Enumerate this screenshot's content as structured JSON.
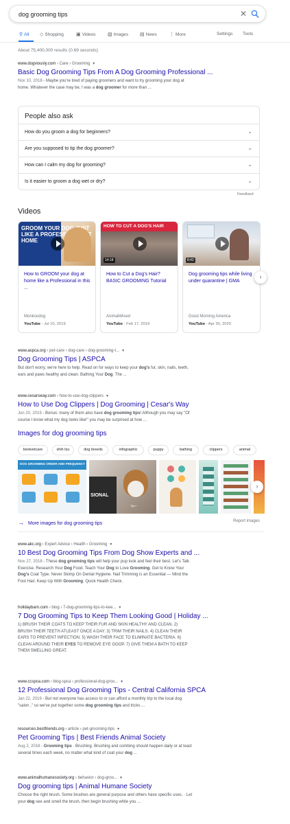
{
  "search": {
    "query": "dog grooming tips",
    "clear_icon": "close-icon",
    "search_icon": "search-icon"
  },
  "tabs": [
    {
      "label": "All",
      "icon": "search-icon",
      "active": true
    },
    {
      "label": "Shopping",
      "icon": "tag-icon"
    },
    {
      "label": "Videos",
      "icon": "video-icon"
    },
    {
      "label": "Images",
      "icon": "image-icon"
    },
    {
      "label": "News",
      "icon": "news-icon"
    },
    {
      "label": "More",
      "icon": "more-vertical-icon"
    }
  ],
  "tools": {
    "settings": "Settings",
    "tools": "Tools"
  },
  "stats": "About 75,400,000 results (0.69 seconds)",
  "colors": {
    "link": "#1a0dab",
    "accent": "#1a73e8",
    "text": "#202124",
    "muted": "#70757a"
  },
  "result1": {
    "domain": "www.dogviously.com",
    "path": " › Care › Grooming",
    "title": "Basic Dog Grooming Tips From A Dog Grooming Professional ...",
    "date": "Nov 10, 2018",
    "snippet_line1": " - Maybe you're tired of paying groomers and want to try grooming your dog at",
    "snippet_line2_a": "home. Whatever the case may be, I was a ",
    "snippet_line2_b": "dog groomer",
    "snippet_line2_c": " for more than ..."
  },
  "paa": {
    "title": "People also ask",
    "questions": [
      "How do you groom a dog for beginners?",
      "Are you supposed to tip the dog groomer?",
      "How can I calm my dog for grooming?",
      "Is it easier to groom a dog wet or dry?"
    ],
    "feedback": "Feedback"
  },
  "videos": {
    "heading": "Videos",
    "items": [
      {
        "title": "How to GROOM your dog at home like a Professional in this ...",
        "source": "Monkoodog",
        "platform": "YouTube",
        "date": " - Jul 10, 2019",
        "duration": "",
        "thumb_text": "GROOM YOUR DOG JUST LIKE A PROFESSIONAL AT HOME"
      },
      {
        "title": "How to Cut a Dog's Hair? BASIC GROOMING Tutorial",
        "source": "AnimalWised",
        "platform": "YouTube",
        "date": " - Feb 17, 2019",
        "duration": "14:18",
        "thumb_text": "HOW TO CUT A DOG'S HAIR"
      },
      {
        "title": "Dog grooming tips while living under quarantine | GMA",
        "source": "Good Morning America",
        "platform": "YouTube",
        "date": " - Apr 30, 2020",
        "duration": "8:42"
      }
    ]
  },
  "result2": {
    "domain": "www.aspca.org",
    "path": " › pet-care › dog-care › dog-grooming-t...",
    "title": "Dog Grooming Tips | ASPCA",
    "line1_a": "But don't worry, we're here to help. Read on for ways to keep your ",
    "line1_b": "dog's",
    "line1_c": " fur, skin, nails, teeth,",
    "line2_a": "ears and paws healthy and clean. Bathing Your ",
    "line2_b": "Dog",
    "line2_c": ". The ..."
  },
  "result3": {
    "domain": "www.cesarsway.com",
    "path": " › how-to-use-dog-clippers",
    "title": "How to Use Dog Clippers | Dog Grooming | Cesar's Way",
    "date": "Jun 20, 2019",
    "line1_a": " - Bonus: many of them also have ",
    "line1_b": "dog grooming tips",
    "line1_c": "! Although you may say \"Of",
    "line2": "course I know what my dog looks like!\" you may be surprised at how ..."
  },
  "images": {
    "heading": "Images for dog grooming tips",
    "chips": [
      "bestvetcare",
      "shih tzu",
      "dog breeds",
      "infographic",
      "puppy",
      "bathing",
      "clippers",
      "animal"
    ],
    "tile1_title": "DOG GROOMING ORDER AND FREQUENCY",
    "tile2_text": "SIONAL",
    "tile2_sub": "Tips ~",
    "more": "More images for dog grooming tips",
    "report": "Report images"
  },
  "result4": {
    "domain": "www.akc.org",
    "path": " › Expert Advice › Health › Grooming",
    "title": "10 Best Dog Grooming Tips From Dog Show Experts and ...",
    "date": "Nov 27, 2018",
    "l1a": " - These ",
    "l1b": "dog grooming tips",
    "l1c": " will help your pup look and feel their best. Let's Talk",
    "l2a": "Exercise. Research Your ",
    "l2b": "Dog",
    "l2c": " Food. Teach Your ",
    "l2d": "Dog",
    "l2e": " to Love ",
    "l2f": "Grooming",
    "l2g": ". Get to Know Your",
    "l3a": "Dog's",
    "l3b": " Coat Type. Never Skimp On Dental Hygiene. Nail Trimming is an Essential — Mind the",
    "l4a": "Foot Hair. Keep Up With ",
    "l4b": "Grooming",
    "l4c": ". Quick Health Check."
  },
  "result5": {
    "domain": "holidaybarn.com",
    "path": " › blog › 7-dog-grooming-tips-to-kee...",
    "title": "7 Dog Grooming Tips to Keep Them Looking Good | Holiday ...",
    "l1": "1) BRUSH THEIR COATS TO KEEP THEIR FUR AND SKIN HEALTHY AND CLEAN. 2)",
    "l2": "BRUSH THEIR TEETH ATLEAST ONCE A DAY. 3) TRIM THEIR NAILS. 4) CLEAN THEIR",
    "l3": "EARS TO PREVENT INFECTION. 5) WASH THEIR FACE TO ELIMINATE BACTERIA. 6)",
    "l4a": "CLEAN AROUND THEIR ",
    "l4b": "EYES",
    "l4c": " TO REMOVE EYE GOOP. 7) GIVE THEM A BATH TO KEEP",
    "l5": "THEM SMELLING GREAT."
  },
  "result6": {
    "domain": "www.ccspca.com",
    "path": " › blog-spca › professional-dog-groo...",
    "title": "12 Professional Dog Grooming Tips - Central California SPCA",
    "date": "Jan 22, 2019",
    "l1": " - But not everyone has access to or can afford a monthly trip to the local dog",
    "l2a": "\"salon ,\" so we've put together some ",
    "l2b": "dog grooming tips",
    "l2c": " and tricks ..."
  },
  "result7": {
    "domain": "resources.bestfriends.org",
    "path": " › article › pet-grooming-tips",
    "title": "Pet Grooming Tips | Best Friends Animal Society",
    "date": "Aug 2, 2018",
    "l1a": " - ",
    "l1b": "Grooming tips",
    "l1c": " · Brushing. Brushing and combing should happen daily or at least",
    "l2a": "several times each week, no matter what kind of coat your ",
    "l2b": "dog",
    "l2c": " ..."
  },
  "result8": {
    "domain": "www.animalhumanesociety.org",
    "path": " › behavior › dog-groo...",
    "title": "Dog grooming tips | Animal Humane Society",
    "l1": "Choose the right brush. Some brushes are general purpose and others have specific uses. · Let",
    "l2a": "your ",
    "l2b": "dog",
    "l2c": " see and smell the brush, then begin brushing while you ..."
  }
}
